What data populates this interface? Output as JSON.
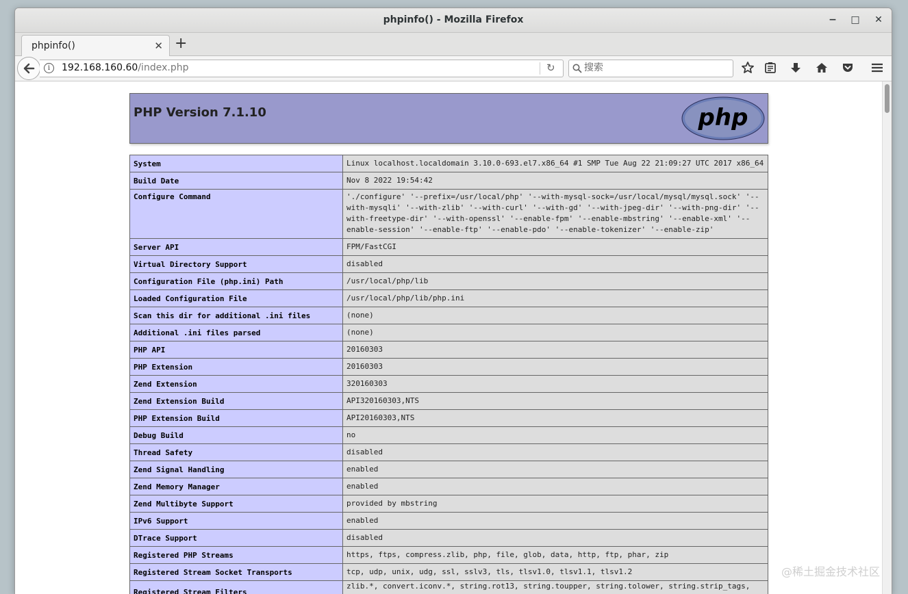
{
  "window": {
    "title": "phpinfo() - Mozilla Firefox",
    "minimize_glyph": "−",
    "maximize_glyph": "□",
    "close_glyph": "✕"
  },
  "tabs": [
    {
      "label": "phpinfo()",
      "close_glyph": "✕"
    }
  ],
  "new_tab_glyph": "+",
  "navbar": {
    "back_glyph": "🡐",
    "url_host": "192.168.160.60",
    "url_path": "/index.php",
    "reload_glyph": "↻",
    "search_placeholder": "搜索",
    "icons": [
      "bookmark-star-icon",
      "reading-list-icon",
      "download-icon",
      "home-icon",
      "pocket-icon",
      "menu-icon"
    ]
  },
  "php": {
    "version_title": "PHP Version 7.1.10",
    "logo_text": "php"
  },
  "info_rows": [
    {
      "key": "System",
      "value": "Linux localhost.localdomain 3.10.0-693.el7.x86_64 #1 SMP Tue Aug 22 21:09:27 UTC 2017 x86_64"
    },
    {
      "key": "Build Date",
      "value": "Nov 8 2022 19:54:42"
    },
    {
      "key": "Configure Command",
      "value": "'./configure' '--prefix=/usr/local/php' '--with-mysql-sock=/usr/local/mysql/mysql.sock' '--with-mysqli' '--with-zlib' '--with-curl' '--with-gd' '--with-jpeg-dir' '--with-png-dir' '--with-freetype-dir' '--with-openssl' '--enable-fpm' '--enable-mbstring' '--enable-xml' '--enable-session' '--enable-ftp' '--enable-pdo' '--enable-tokenizer' '--enable-zip'"
    },
    {
      "key": "Server API",
      "value": "FPM/FastCGI"
    },
    {
      "key": "Virtual Directory Support",
      "value": "disabled"
    },
    {
      "key": "Configuration File (php.ini) Path",
      "value": "/usr/local/php/lib"
    },
    {
      "key": "Loaded Configuration File",
      "value": "/usr/local/php/lib/php.ini"
    },
    {
      "key": "Scan this dir for additional .ini files",
      "value": "(none)"
    },
    {
      "key": "Additional .ini files parsed",
      "value": "(none)"
    },
    {
      "key": "PHP API",
      "value": "20160303"
    },
    {
      "key": "PHP Extension",
      "value": "20160303"
    },
    {
      "key": "Zend Extension",
      "value": "320160303"
    },
    {
      "key": "Zend Extension Build",
      "value": "API320160303,NTS"
    },
    {
      "key": "PHP Extension Build",
      "value": "API20160303,NTS"
    },
    {
      "key": "Debug Build",
      "value": "no"
    },
    {
      "key": "Thread Safety",
      "value": "disabled"
    },
    {
      "key": "Zend Signal Handling",
      "value": "enabled"
    },
    {
      "key": "Zend Memory Manager",
      "value": "enabled"
    },
    {
      "key": "Zend Multibyte Support",
      "value": "provided by mbstring"
    },
    {
      "key": "IPv6 Support",
      "value": "enabled"
    },
    {
      "key": "DTrace Support",
      "value": "disabled"
    },
    {
      "key": "Registered PHP Streams",
      "value": "https, ftps, compress.zlib, php, file, glob, data, http, ftp, phar, zip"
    },
    {
      "key": "Registered Stream Socket Transports",
      "value": "tcp, udp, unix, udg, ssl, sslv3, tls, tlsv1.0, tlsv1.1, tlsv1.2"
    },
    {
      "key": "Registered Stream Filters",
      "value": "zlib.*, convert.iconv.*, string.rot13, string.toupper, string.tolower, string.strip_tags, convert.*, consumed,"
    }
  ],
  "watermark": "@稀土掘金技术社区",
  "colors": {
    "header_bg": "#9999cc",
    "key_bg": "#ccccff",
    "value_bg": "#dddddd"
  }
}
